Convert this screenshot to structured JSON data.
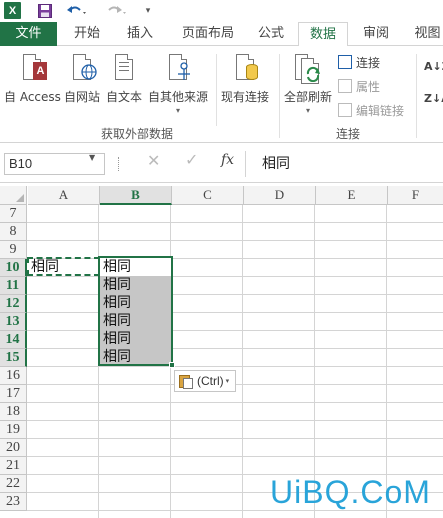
{
  "app": {
    "logo_letter": "X"
  },
  "quick_access": {
    "more": "▾"
  },
  "tabs": {
    "file": "文件",
    "home": "开始",
    "insert": "插入",
    "layout": "页面布局",
    "formula": "公式",
    "data": "数据",
    "review": "审阅",
    "view": "视图"
  },
  "ribbon": {
    "access": "自 Access",
    "web": "自网站",
    "text": "自文本",
    "other": "自其他来源",
    "existing": "现有连接",
    "refresh": "全部刷新",
    "connections": "连接",
    "properties": "属性",
    "edit_links": "编辑链接",
    "group_external": "获取外部数据",
    "group_connections": "连接",
    "sort_az": "A↓Z",
    "sort_za": "Z↓A",
    "access_glyph": "A",
    "access_color": "#a4373a"
  },
  "formula_bar": {
    "name_box": "B10",
    "cancel_icon": "✕",
    "enter_icon": "✓",
    "fx_icon": "fx",
    "value": "相同"
  },
  "columns": [
    "A",
    "B",
    "C",
    "D",
    "E",
    "F"
  ],
  "selected_column": "B",
  "rows": [
    "7",
    "8",
    "9",
    "10",
    "11",
    "12",
    "13",
    "14",
    "15",
    "16",
    "17",
    "18",
    "19",
    "20",
    "21",
    "22",
    "23"
  ],
  "selected_rows": [
    "10",
    "11",
    "12",
    "13",
    "14",
    "15"
  ],
  "cells": {
    "A10": "相同",
    "B10": "相同",
    "B11": "相同",
    "B12": "相同",
    "B13": "相同",
    "B14": "相同",
    "B15": "相同"
  },
  "paste_options": {
    "label": "(Ctrl)",
    "arrow": "▾"
  },
  "watermark": "UiBQ.CoM",
  "colors": {
    "accent": "#217346",
    "selection_fill": "#c6c6c6",
    "watermark": "#29a4d9"
  }
}
